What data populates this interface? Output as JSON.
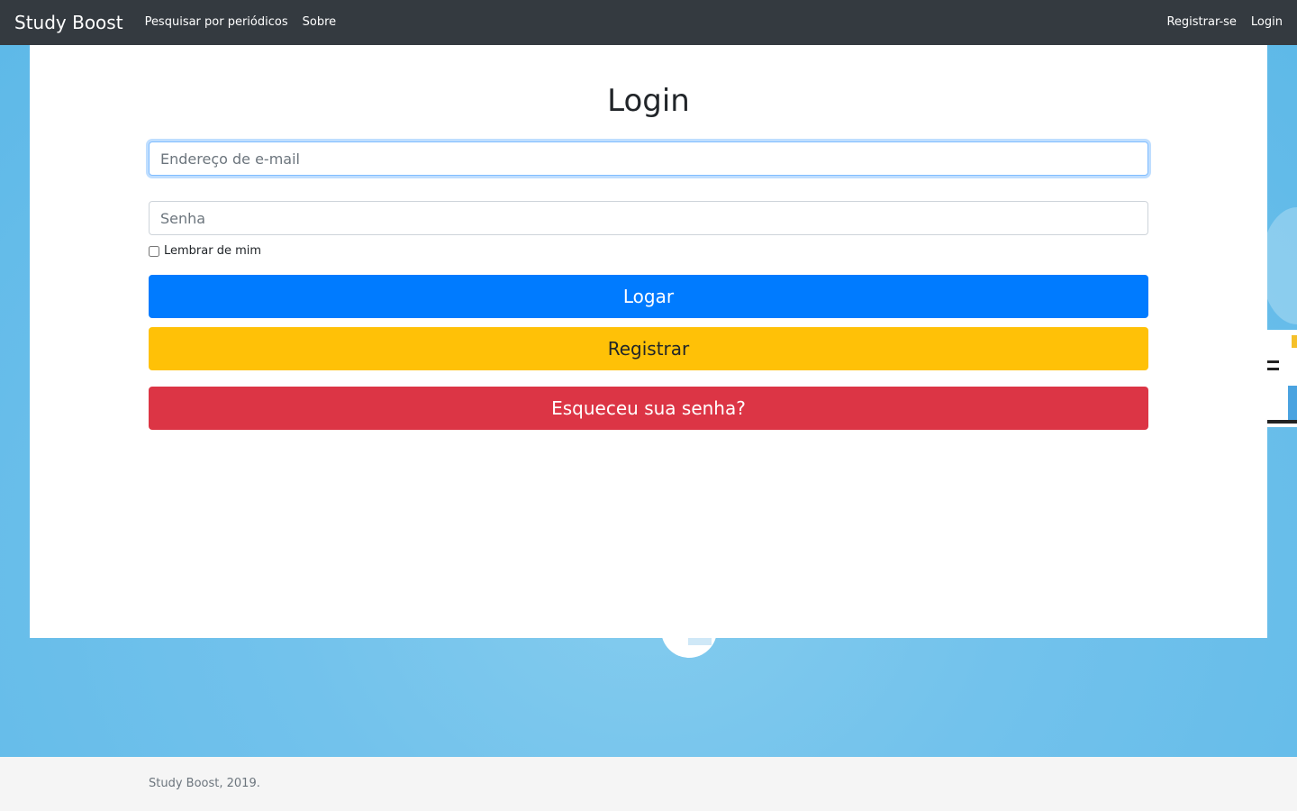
{
  "navbar": {
    "brand": "Study Boost",
    "left_links": [
      {
        "label": "Pesquisar por periódicos"
      },
      {
        "label": "Sobre"
      }
    ],
    "right_links": [
      {
        "label": "Registrar-se"
      },
      {
        "label": "Login"
      }
    ]
  },
  "login_form": {
    "title": "Login",
    "email_placeholder": "Endereço de e-mail",
    "email_value": "",
    "password_placeholder": "Senha",
    "password_value": "",
    "remember_label": "Lembrar de mim",
    "remember_checked": false,
    "login_button": "Logar",
    "register_button": "Registrar",
    "forgot_button": "Esqueceu sua senha?"
  },
  "footer": {
    "text": "Study Boost, 2019."
  },
  "colors": {
    "navbar": "#343a40",
    "background_blue": "#72c2ec",
    "primary": "#007bff",
    "warning": "#ffc107",
    "danger": "#dc3545",
    "footer_bg": "#f5f5f5"
  }
}
